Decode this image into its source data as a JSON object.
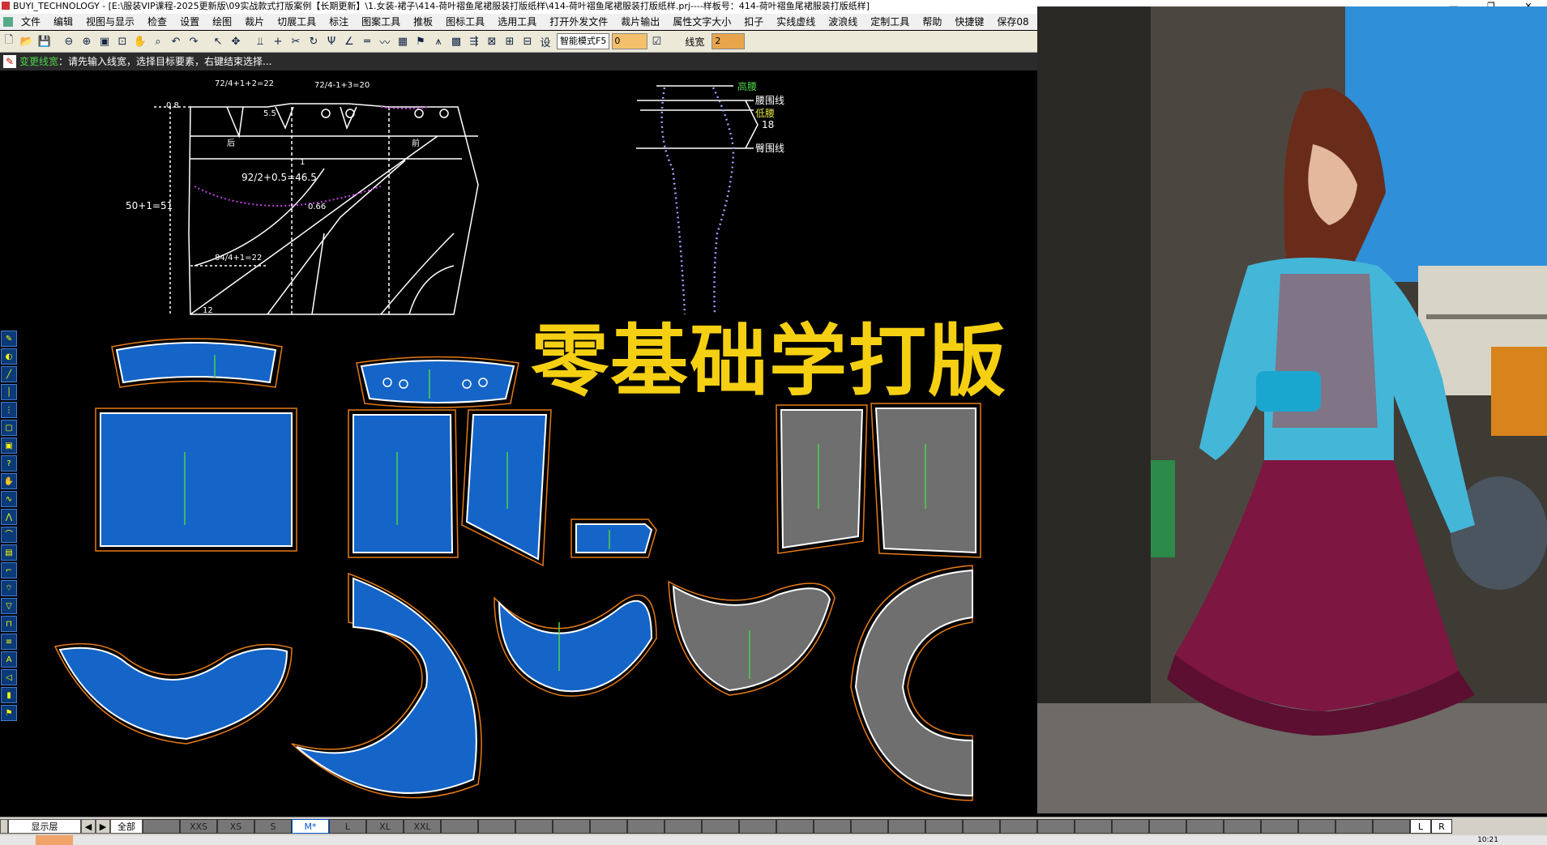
{
  "window": {
    "title": "BUYI_TECHNOLOGY - [E:\\服装VIP课程-2025更新版\\09实战款式打版案例【长期更新】\\1.女装-裙子\\414-荷叶褶鱼尾裙服装打版纸样\\414-荷叶褶鱼尾裙服装打版纸样.prj----样板号：414-荷叶褶鱼尾裙服装打版纸样]",
    "minimize": "—",
    "maximize": "❐",
    "close": "✕"
  },
  "menu": [
    "文件",
    "编辑",
    "视图与显示",
    "检查",
    "设置",
    "绘图",
    "裁片",
    "切展工具",
    "标注",
    "图案工具",
    "推板",
    "图标工具",
    "选用工具",
    "打开外发文件",
    "裁片输出",
    "属性文字大小",
    "扣子",
    "实线虚线",
    "波浪线",
    "定制工具",
    "帮助",
    "快捷键",
    "保存08"
  ],
  "toolbar": {
    "mode_select": "智能模式F5",
    "value_input": "0",
    "line_width_label": "线宽",
    "line_width_value": "2"
  },
  "status": {
    "mode": "变更线宽",
    "prompt": "：请先输入线宽，选择目标要素，右键结束选择..."
  },
  "draft": {
    "label_waist_left": "72/4+1+2=22",
    "label_waist_right": "72/4-1+3=20",
    "label_hip": "92/2+0.5=46.5",
    "label_length": "50+1=51",
    "label_hem": "84/4+1=22",
    "label_08": "0.8",
    "label_55": "5.5",
    "label_066": "0.66",
    "label_12": "12",
    "label_front": "后",
    "label_back": "前",
    "label_1": "1"
  },
  "body_ref": {
    "high_waist": "高腰",
    "waist_line": "腰围线",
    "low_waist": "低腰",
    "val_18": "18",
    "hip_line": "臀围线"
  },
  "promo_title": "零基础学打版",
  "bottom": {
    "layer_label": "显示层",
    "all_label": "全部",
    "sizes": [
      "XXS",
      "XS",
      "S",
      "M*",
      "L",
      "XL",
      "XXL"
    ],
    "active_size": "M*",
    "left_btn": "L",
    "right_btn": "R",
    "clock": "10:21"
  },
  "colors": {
    "piece_blue": "#1565c8",
    "piece_grey": "#6f6f6f",
    "seam_orange": "#e57a15",
    "title_yellow": "#f5d012"
  }
}
